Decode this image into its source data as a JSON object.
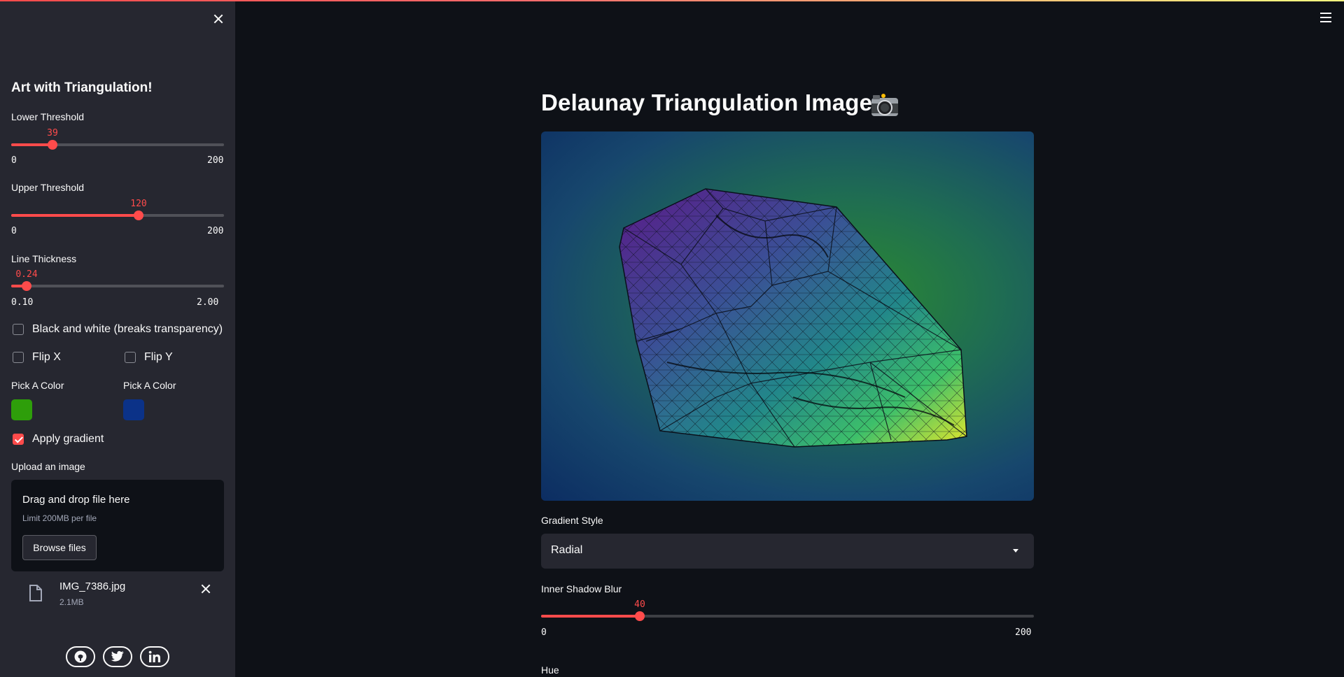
{
  "sidebar": {
    "title": "Art with Triangulation!",
    "lower_threshold": {
      "label": "Lower Threshold",
      "value": "39",
      "min": "0",
      "max": "200",
      "fraction": 0.195
    },
    "upper_threshold": {
      "label": "Upper Threshold",
      "value": "120",
      "min": "0",
      "max": "200",
      "fraction": 0.6
    },
    "line_thickness": {
      "label": "Line Thickness",
      "value": "0.24",
      "min": "0.10",
      "max": "2.00",
      "fraction": 0.074
    },
    "bw_checkbox": {
      "label": "Black and white (breaks transparency)",
      "checked": false
    },
    "flip_x": {
      "label": "Flip X",
      "checked": false
    },
    "flip_y": {
      "label": "Flip Y",
      "checked": false
    },
    "color_1": {
      "label": "Pick A Color",
      "color": "#2e9e0a"
    },
    "color_2": {
      "label": "Pick A Color",
      "color": "#0b3288"
    },
    "apply_gradient": {
      "label": "Apply gradient",
      "checked": true
    },
    "uploader": {
      "label": "Upload an image",
      "drop_text": "Drag and drop file here",
      "limit_text": "Limit 200MB per file",
      "browse_label": "Browse files"
    },
    "file": {
      "name": "IMG_7386.jpg",
      "size": "2.1MB"
    },
    "social": [
      "github-icon",
      "twitter-icon",
      "linkedin-icon"
    ]
  },
  "main": {
    "title": "Delaunay Triangulation Image",
    "title_icon": "camera-icon",
    "gradient_style": {
      "label": "Gradient Style",
      "value": "Radial"
    },
    "inner_shadow_blur": {
      "label": "Inner Shadow Blur",
      "value": "40",
      "min": "0",
      "max": "200",
      "fraction": 0.2
    },
    "hue_label": "Hue"
  },
  "colors": {
    "accent": "#ff4b4b",
    "background": "#0e1117",
    "sidebar": "#262730"
  }
}
